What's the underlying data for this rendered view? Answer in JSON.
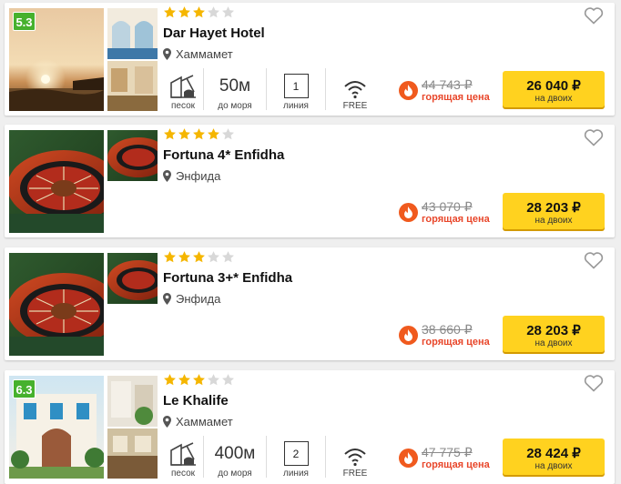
{
  "colors": {
    "rating_bg": "#46b12d",
    "star_filled": "#f5b600",
    "star_empty": "#d8d8d8",
    "hot_red": "#e8462a",
    "fire_orange": "#f05a1e",
    "button_yellow": "#ffd21f"
  },
  "icons": {
    "pin": "map-pin-icon",
    "favorite": "heart-icon",
    "beach": "sand-beach-icon",
    "wifi": "wifi-icon",
    "hot": "fire-icon"
  },
  "hotels": [
    {
      "rating": "5.3",
      "stars": 3,
      "name": "Dar Hayet Hotel",
      "location": "Хаммамет",
      "features": {
        "beach_label": "песок",
        "distance": "50м",
        "distance_label": "до моря",
        "line": "1",
        "line_label": "линия",
        "wifi_label": "FREE"
      },
      "old_price": "44 743 ₽",
      "hot_label": "горящая цена",
      "price": "26 040 ₽",
      "price_sub": "на двоих"
    },
    {
      "rating": "",
      "stars": 4,
      "name": "Fortuna 4* Enfidha",
      "location": "Энфида",
      "features": null,
      "old_price": "43 070 ₽",
      "hot_label": "горящая цена",
      "price": "28 203 ₽",
      "price_sub": "на двоих"
    },
    {
      "rating": "",
      "stars": 3,
      "name": "Fortuna 3+* Enfidha",
      "location": "Энфида",
      "features": null,
      "old_price": "38 660 ₽",
      "hot_label": "горящая цена",
      "price": "28 203 ₽",
      "price_sub": "на двоих"
    },
    {
      "rating": "6.3",
      "stars": 3,
      "name": "Le Khalife",
      "location": "Хаммамет",
      "features": {
        "beach_label": "песок",
        "distance": "400м",
        "distance_label": "до моря",
        "line": "2",
        "line_label": "линия",
        "wifi_label": "FREE"
      },
      "old_price": "47 775 ₽",
      "hot_label": "горящая цена",
      "price": "28 424 ₽",
      "price_sub": "на двоих"
    }
  ]
}
